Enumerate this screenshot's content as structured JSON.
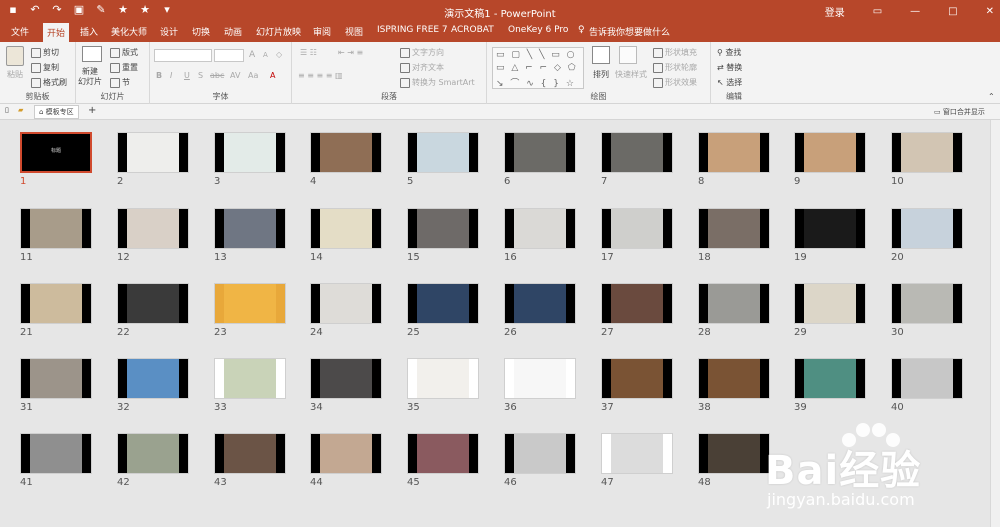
{
  "window": {
    "title": "演示文稿1 - PowerPoint",
    "login": "登录",
    "quick_access": [
      "save-icon",
      "undo-icon",
      "redo-icon",
      "slideshow-icon",
      "brush-icon",
      "star-icon",
      "star-icon",
      "customize-icon"
    ],
    "controls": [
      "restore-ribbon-icon",
      "minimize-icon",
      "maximize-icon",
      "close-icon"
    ]
  },
  "tabs": [
    "文件",
    "开始",
    "插入",
    "美化大师",
    "设计",
    "切换",
    "动画",
    "幻灯片放映",
    "审阅",
    "视图",
    "ISPRING FREE 7",
    "ACROBAT",
    "OneKey 6 Pro",
    "告诉我你想要做什么"
  ],
  "active_tab": "开始",
  "ribbon": {
    "clipboard": {
      "label": "剪贴板",
      "paste": "粘贴",
      "cut": "剪切",
      "copy": "复制",
      "format_painter": "格式刷"
    },
    "slides": {
      "label": "幻灯片",
      "new_slide_1": "新建",
      "new_slide_2": "幻灯片",
      "layout": "版式",
      "reset": "重置",
      "section": "节"
    },
    "font": {
      "label": "字体",
      "bold": "B",
      "italic": "I",
      "underline": "U",
      "strike": "S",
      "shadow": "abc",
      "spacing": "AV",
      "case": "Aa",
      "grow": "A",
      "shrink": "A"
    },
    "paragraph": {
      "label": "段落",
      "text_direction": "文字方向",
      "align_text": "对齐文本",
      "smartart": "转换为 SmartArt"
    },
    "drawing": {
      "label": "绘图",
      "arrange": "排列",
      "quick_styles": "快速样式",
      "fill": "形状填充",
      "outline": "形状轮廓",
      "effects": "形状效果"
    },
    "editing": {
      "label": "编辑",
      "find": "查找",
      "replace": "替换",
      "select": "选择"
    }
  },
  "subbar": {
    "template_zone": "模板专区",
    "add": "+",
    "merge_window": "窗口合并显示"
  },
  "slides": [
    {
      "n": "1",
      "bg": "#000000",
      "ph": "#000000",
      "caption": "标题"
    },
    {
      "n": "2",
      "bg": "#000000",
      "ph": "#eeeeec"
    },
    {
      "n": "3",
      "bg": "#000000",
      "ph": "#e3ebe8"
    },
    {
      "n": "4",
      "bg": "#000000",
      "ph": "#8f6e55"
    },
    {
      "n": "5",
      "bg": "#000000",
      "ph": "#c9d7df"
    },
    {
      "n": "6",
      "bg": "#000000",
      "ph": "#6b6a66"
    },
    {
      "n": "7",
      "bg": "#000000",
      "ph": "#6b6a66"
    },
    {
      "n": "8",
      "bg": "#000000",
      "ph": "#c8a07a"
    },
    {
      "n": "9",
      "bg": "#000000",
      "ph": "#c8a07a"
    },
    {
      "n": "10",
      "bg": "#000000",
      "ph": "#d2c5b3"
    },
    {
      "n": "11",
      "bg": "#000000",
      "ph": "#a89c8a"
    },
    {
      "n": "12",
      "bg": "#000000",
      "ph": "#d9d0c7"
    },
    {
      "n": "13",
      "bg": "#000000",
      "ph": "#6f7683"
    },
    {
      "n": "14",
      "bg": "#000000",
      "ph": "#e4ddc6"
    },
    {
      "n": "15",
      "bg": "#000000",
      "ph": "#6e6a68"
    },
    {
      "n": "16",
      "bg": "#000000",
      "ph": "#dad9d6"
    },
    {
      "n": "17",
      "bg": "#000000",
      "ph": "#cfcfcc"
    },
    {
      "n": "18",
      "bg": "#000000",
      "ph": "#7a6e66"
    },
    {
      "n": "19",
      "bg": "#000000",
      "ph": "#1a1a1a"
    },
    {
      "n": "20",
      "bg": "#000000",
      "ph": "#c7d2dc"
    },
    {
      "n": "21",
      "bg": "#000000",
      "ph": "#cdbb9d"
    },
    {
      "n": "22",
      "bg": "#000000",
      "ph": "#3a3a3a"
    },
    {
      "n": "23",
      "bg": "#e8a83a",
      "ph": "#f0b545"
    },
    {
      "n": "24",
      "bg": "#000000",
      "ph": "#dedcd8"
    },
    {
      "n": "25",
      "bg": "#000000",
      "ph": "#2f4565"
    },
    {
      "n": "26",
      "bg": "#000000",
      "ph": "#2f4565"
    },
    {
      "n": "27",
      "bg": "#000000",
      "ph": "#6a4a3e"
    },
    {
      "n": "28",
      "bg": "#000000",
      "ph": "#9a9a96"
    },
    {
      "n": "29",
      "bg": "#000000",
      "ph": "#dcd6c8"
    },
    {
      "n": "30",
      "bg": "#000000",
      "ph": "#b9b9b4"
    },
    {
      "n": "31",
      "bg": "#000000",
      "ph": "#9c948a"
    },
    {
      "n": "32",
      "bg": "#000000",
      "ph": "#5a8fc4"
    },
    {
      "n": "33",
      "bg": "#ffffff",
      "ph": "#c9d3b8"
    },
    {
      "n": "34",
      "bg": "#000000",
      "ph": "#4c4a4a"
    },
    {
      "n": "35",
      "bg": "#ffffff",
      "ph": "#f2f0ec"
    },
    {
      "n": "36",
      "bg": "#ffffff",
      "ph": "#f7f7f7"
    },
    {
      "n": "37",
      "bg": "#000000",
      "ph": "#7a5334"
    },
    {
      "n": "38",
      "bg": "#000000",
      "ph": "#7a5334"
    },
    {
      "n": "39",
      "bg": "#000000",
      "ph": "#4f8f82"
    },
    {
      "n": "40",
      "bg": "#000000",
      "ph": "#c7c7c7"
    },
    {
      "n": "41",
      "bg": "#000000",
      "ph": "#8f8f8f"
    },
    {
      "n": "42",
      "bg": "#000000",
      "ph": "#9aa28f"
    },
    {
      "n": "43",
      "bg": "#000000",
      "ph": "#6b5446"
    },
    {
      "n": "44",
      "bg": "#000000",
      "ph": "#c3a892"
    },
    {
      "n": "45",
      "bg": "#000000",
      "ph": "#8a5a5f"
    },
    {
      "n": "46",
      "bg": "#000000",
      "ph": "#c9c9c9"
    },
    {
      "n": "47",
      "bg": "#ffffff",
      "ph": "#dcdcdc"
    },
    {
      "n": "48",
      "bg": "#000000",
      "ph": "#4a4036"
    }
  ],
  "selected_slide": "1",
  "watermark": {
    "brand": "Bai经验",
    "url": "jingyan.baidu.com"
  },
  "colors": {
    "accent": "#b7472a",
    "selected": "#d04a2e"
  }
}
